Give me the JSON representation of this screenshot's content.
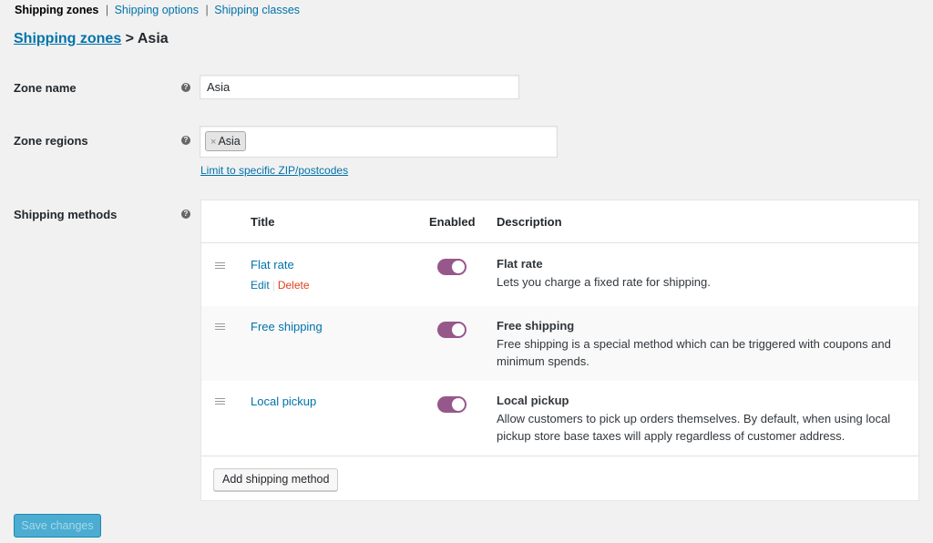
{
  "subnav": {
    "items": [
      {
        "label": "Shipping zones",
        "current": true
      },
      {
        "label": "Shipping options",
        "current": false
      },
      {
        "label": "Shipping classes",
        "current": false
      }
    ],
    "separator": "|"
  },
  "breadcrumb": {
    "parent": "Shipping zones",
    "separator": ">",
    "current": "Asia"
  },
  "help_icon": "?",
  "form": {
    "zone_name": {
      "label": "Zone name",
      "value": "Asia"
    },
    "zone_regions": {
      "label": "Zone regions",
      "chips": [
        {
          "remove": "×",
          "label": "Asia"
        }
      ],
      "limit_link": "Limit to specific ZIP/postcodes"
    },
    "shipping_methods": {
      "label": "Shipping methods"
    }
  },
  "methods_table": {
    "columns": {
      "title": "Title",
      "enabled": "Enabled",
      "description": "Description"
    },
    "rows": [
      {
        "title": "Flat rate",
        "enabled": true,
        "desc_title": "Flat rate",
        "desc": "Lets you charge a fixed rate for shipping.",
        "actions": {
          "edit": "Edit",
          "sep": "|",
          "delete": "Delete"
        }
      },
      {
        "title": "Free shipping",
        "enabled": true,
        "desc_title": "Free shipping",
        "desc": "Free shipping is a special method which can be triggered with coupons and minimum spends."
      },
      {
        "title": "Local pickup",
        "enabled": true,
        "desc_title": "Local pickup",
        "desc": "Allow customers to pick up orders themselves. By default, when using local pickup store base taxes will apply regardless of customer address."
      }
    ],
    "add_button": "Add shipping method"
  },
  "save_button": "Save changes",
  "colors": {
    "accent": "#96588a",
    "link": "#0073aa",
    "delete": "#e2401c",
    "primary": "#2ea2cc"
  }
}
